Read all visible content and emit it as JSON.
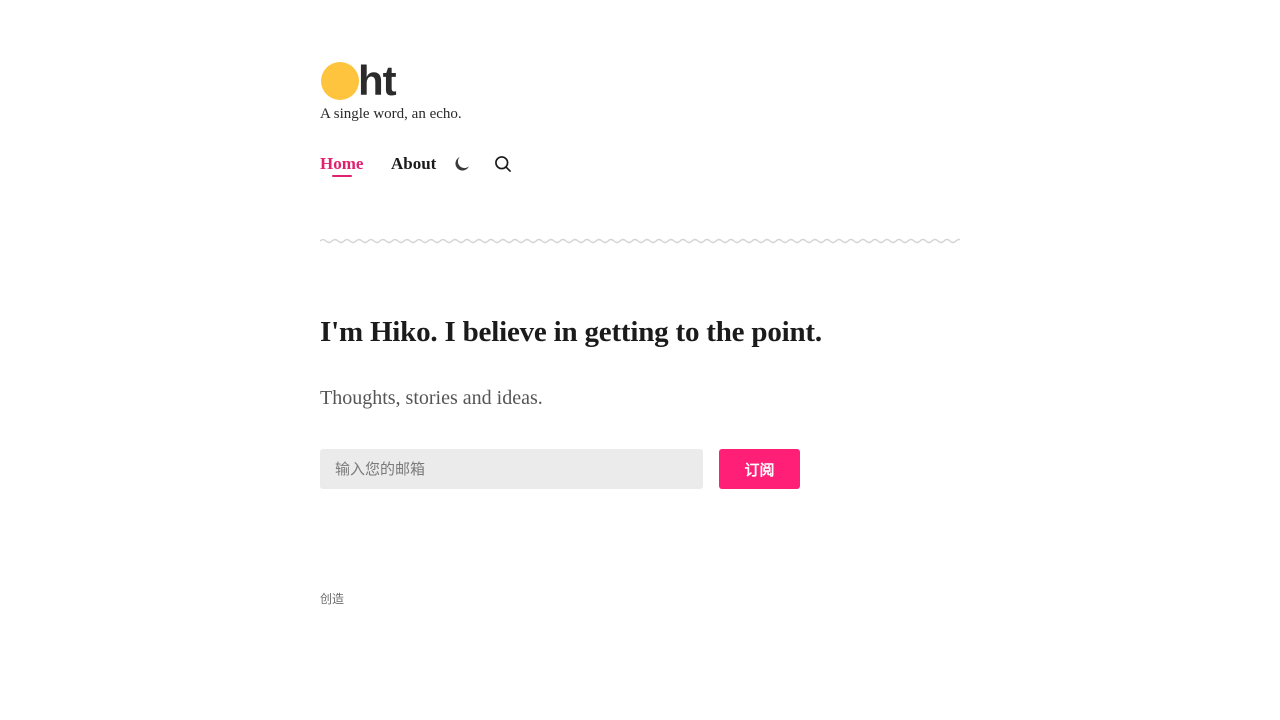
{
  "site": {
    "logo_text": "ht",
    "tagline": "A single word, an echo."
  },
  "nav": {
    "items": [
      {
        "label": "Home",
        "active": true
      },
      {
        "label": "About",
        "active": false
      }
    ],
    "icons": [
      "moon-icon",
      "search-icon"
    ]
  },
  "hero": {
    "title": "I'm Hiko. I believe in getting to the point.",
    "subtitle": "Thoughts, stories and ideas."
  },
  "subscribe": {
    "placeholder": "输入您的邮箱",
    "button_label": "订阅"
  },
  "footer": {
    "text": "创造"
  },
  "colors": {
    "accent": "#e0216f",
    "button": "#ff1f77",
    "logo_dot": "#ffc43d",
    "input_bg": "#ebebeb"
  }
}
